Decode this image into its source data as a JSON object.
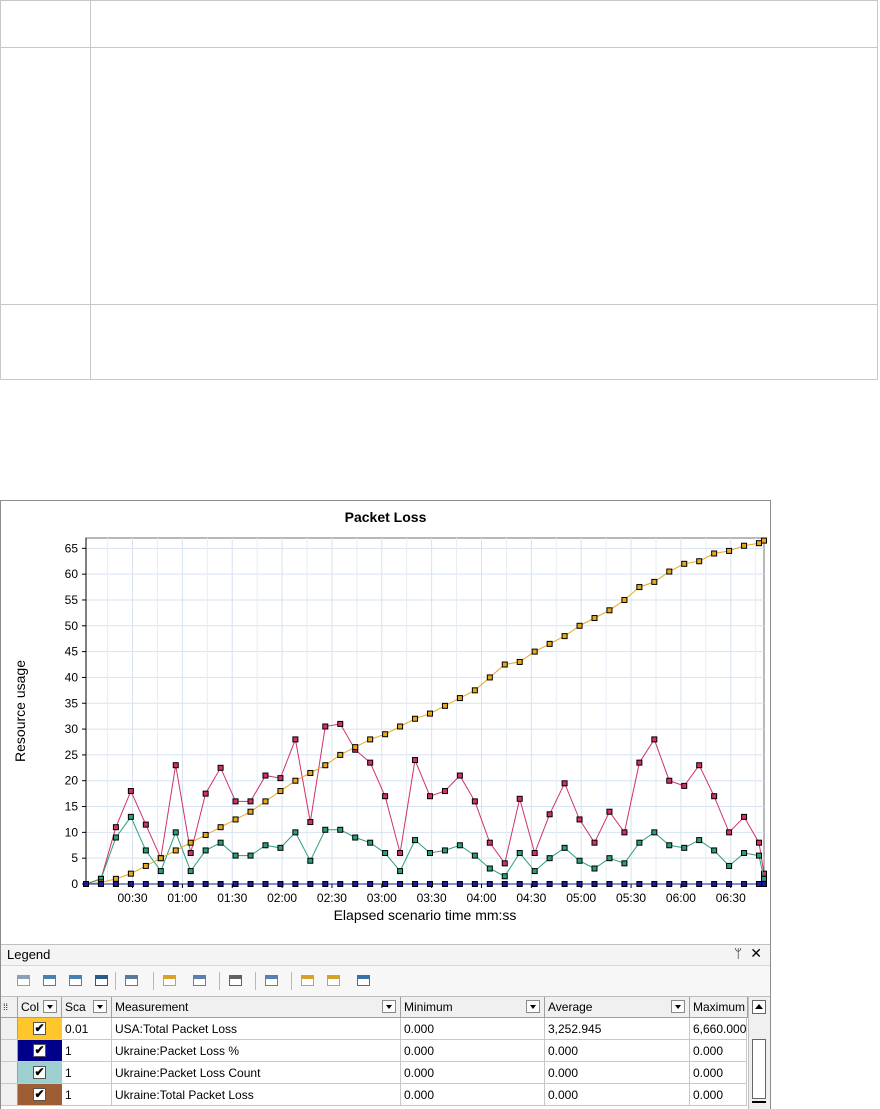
{
  "chart_data": {
    "type": "line",
    "title": "Packet Loss",
    "xlabel": "Elapsed scenario time mm:ss",
    "ylabel": "Resource usage",
    "ylim": [
      0,
      67
    ],
    "y_ticks": [
      "0",
      "5",
      "10",
      "15",
      "20",
      "25",
      "30",
      "35",
      "40",
      "45",
      "50",
      "55",
      "60",
      "65"
    ],
    "x_ticks": [
      "00:30",
      "01:00",
      "01:30",
      "02:00",
      "02:30",
      "03:00",
      "03:30",
      "04:00",
      "04:30",
      "05:00",
      "05:30",
      "06:00",
      "06:30"
    ],
    "xlim_seconds": [
      2,
      410
    ],
    "grid": true,
    "series": [
      {
        "color": "#d0326a",
        "x": [
          2,
          11,
          20,
          29,
          38,
          47,
          56,
          65,
          74,
          83,
          92,
          101,
          110,
          119,
          128,
          137,
          146,
          155,
          164,
          173,
          182,
          191,
          200,
          209,
          218,
          227,
          236,
          245,
          254,
          263,
          272,
          281,
          290,
          299,
          308,
          317,
          326,
          335,
          344,
          353,
          362,
          371,
          380,
          389,
          398,
          407,
          410
        ],
        "values": [
          0,
          1,
          11,
          18,
          11.5,
          5,
          23,
          6,
          17.5,
          22.5,
          16,
          16,
          21,
          20.5,
          28,
          12,
          30.5,
          31,
          26,
          23.5,
          17,
          6,
          24,
          17,
          18,
          21,
          16,
          8,
          4,
          16.5,
          6,
          13.5,
          19.5,
          12.5,
          8,
          14,
          10,
          23.5,
          28,
          20,
          19,
          23,
          17,
          10,
          13,
          8,
          2
        ]
      },
      {
        "color": "#2e9e7a",
        "x": [
          2,
          11,
          20,
          29,
          38,
          47,
          56,
          65,
          74,
          83,
          92,
          101,
          110,
          119,
          128,
          137,
          146,
          155,
          164,
          173,
          182,
          191,
          200,
          209,
          218,
          227,
          236,
          245,
          254,
          263,
          272,
          281,
          290,
          299,
          308,
          317,
          326,
          335,
          344,
          353,
          362,
          371,
          380,
          389,
          398,
          407,
          410
        ],
        "values": [
          0,
          1,
          9,
          13,
          6.5,
          2.5,
          10,
          2.5,
          6.5,
          8,
          5.5,
          5.5,
          7.5,
          7,
          10,
          4.5,
          10.5,
          10.5,
          9,
          8,
          6,
          2.5,
          8.5,
          6,
          6.5,
          7.5,
          5.5,
          3,
          1.5,
          6,
          2.5,
          5,
          7,
          4.5,
          3,
          5,
          4,
          8,
          10,
          7.5,
          7,
          8.5,
          6.5,
          3.5,
          6,
          5.5,
          1
        ]
      },
      {
        "color": "#e6a81e",
        "x": [
          2,
          11,
          20,
          29,
          38,
          47,
          56,
          65,
          74,
          83,
          92,
          101,
          110,
          119,
          128,
          137,
          146,
          155,
          164,
          173,
          182,
          191,
          200,
          209,
          218,
          227,
          236,
          245,
          254,
          263,
          272,
          281,
          290,
          299,
          308,
          317,
          326,
          335,
          344,
          353,
          362,
          371,
          380,
          389,
          398,
          407,
          410
        ],
        "values": [
          0,
          0.3,
          1,
          2,
          3.5,
          5,
          6.5,
          8,
          9.5,
          11,
          12.5,
          14,
          16,
          18,
          20,
          21.5,
          23,
          25,
          26.5,
          28,
          29,
          30.5,
          32,
          33,
          34.5,
          36,
          37.5,
          40,
          42.5,
          43,
          45,
          46.5,
          48,
          50,
          51.5,
          53,
          55,
          57.5,
          58.5,
          60.5,
          62,
          62.5,
          64,
          64.5,
          65.5,
          66,
          66.5
        ]
      },
      {
        "color": "#1a1aa0",
        "x": [
          2,
          11,
          20,
          29,
          38,
          47,
          56,
          65,
          74,
          83,
          92,
          101,
          110,
          119,
          128,
          137,
          146,
          155,
          164,
          173,
          182,
          191,
          200,
          209,
          218,
          227,
          236,
          245,
          254,
          263,
          272,
          281,
          290,
          299,
          308,
          317,
          326,
          335,
          344,
          353,
          362,
          371,
          380,
          389,
          398,
          407,
          410
        ],
        "values": [
          0,
          0,
          0,
          0,
          0,
          0,
          0,
          0,
          0,
          0,
          0,
          0,
          0,
          0,
          0,
          0,
          0,
          0,
          0,
          0,
          0,
          0,
          0,
          0,
          0,
          0,
          0,
          0,
          0,
          0,
          0,
          0,
          0,
          0,
          0,
          0,
          0,
          0,
          0,
          0,
          0,
          0,
          0,
          0,
          0,
          0,
          0
        ]
      }
    ]
  },
  "legend": {
    "title": "Legend",
    "pin_glyph": "📌",
    "close_glyph": "✕",
    "columns": {
      "color": "Col",
      "scale": "Sca",
      "measurement": "Measurement",
      "minimum": "Minimum",
      "average": "Average",
      "maximum": "Maximum"
    },
    "rows": [
      {
        "color": "#ffc72c",
        "checked": "✔",
        "scale": "0.01",
        "measurement": "USA:Total Packet Loss",
        "minimum": "0.000",
        "average": "3,252.945",
        "maximum": "6,660.000"
      },
      {
        "color": "#00008b",
        "checked": "✔",
        "scale": "1",
        "measurement": "Ukraine:Packet Loss %",
        "minimum": "0.000",
        "average": "0.000",
        "maximum": "0.000"
      },
      {
        "color": "#9fd0d0",
        "checked": "✔",
        "scale": "1",
        "measurement": "Ukraine:Packet Loss Count",
        "minimum": "0.000",
        "average": "0.000",
        "maximum": "0.000"
      },
      {
        "color": "#9c5e32",
        "checked": "✔",
        "scale": "1",
        "measurement": "Ukraine:Total Packet Loss",
        "minimum": "0.000",
        "average": "0.000",
        "maximum": "0.000"
      }
    ]
  },
  "toolbar_icons": [
    "show-only-selected-icon",
    "configure-measurements-icon",
    "show-all-icon",
    "hide-icon",
    "filter-icon",
    "export-icon",
    "copy-icon",
    "screenshot-icon",
    "columns-icon",
    "autocorrelate-icon",
    "correlate-icon",
    "save-layout-icon"
  ]
}
